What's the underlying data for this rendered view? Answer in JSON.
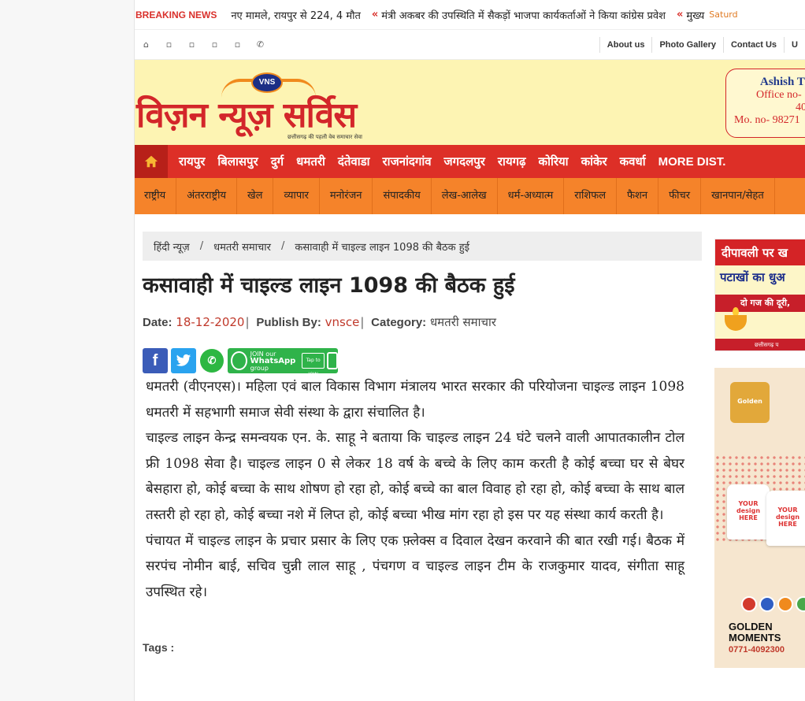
{
  "breaking": {
    "label": "BREAKING NEWS",
    "items": [
      "नए मामले, रायपुर से 224, 4 मौत",
      "मंत्री अकबर की उपस्थिति में सैकड़ों भाजपा कार्यकर्ताओं ने किया कांग्रेस प्रवेश",
      "मुख्य"
    ],
    "date": "Saturd"
  },
  "topbar": {
    "social_icons": [
      "home-icon",
      "facebook-icon",
      "twitter-icon",
      "youtube-icon",
      "instagram-icon",
      "whatsapp-icon"
    ],
    "links": [
      "About us",
      "Photo Gallery",
      "Contact Us",
      "U"
    ]
  },
  "masthead": {
    "logo_badge": "VNS",
    "logo_title": "विज़न न्यूज़ सर्विस",
    "logo_tagline": "छत्तीसगढ़ की पहली वेब समाचार सेवा",
    "contact_name": "Ashish T",
    "contact_office": "Office no-",
    "contact_office2": "40",
    "contact_mobile": "Mo. no- 98271"
  },
  "nav_red": {
    "items": [
      "रायपुर",
      "बिलासपुर",
      "दुर्ग",
      "धमतरी",
      "दंतेवाडा",
      "राजनांदगांव",
      "जगदलपुर",
      "रायगढ़",
      "कोरिया",
      "कांकेर",
      "कवर्धा"
    ],
    "more": "MORE DIST."
  },
  "nav_orange": {
    "items": [
      "राष्ट्रीय",
      "अंतरराष्ट्रीय",
      "खेल",
      "व्यापार",
      "मनोरंजन",
      "संपादकीय",
      "लेख-आलेख",
      "धर्म-अध्यात्म",
      "राशिफल",
      "फैशन",
      "फीचर",
      "खानपान/सेहत"
    ]
  },
  "breadcrumb": [
    "हिंदी न्यूज़",
    "धमतरी समाचार",
    "कसावाही में चाइल्ड लाइन 1098 की बैठक हुई"
  ],
  "article": {
    "title": "कसावाही में चाइल्ड लाइन 1098 की बैठक हुई",
    "date_label": "Date:",
    "date": "18-12-2020",
    "publish_label": "Publish By:",
    "publisher": "vnsce",
    "category_label": "Category:",
    "category": "धमतरी समाचार",
    "paragraphs": [
      "धमतरी (वीएनएस)। महिला एवं बाल विकास विभाग मंत्रालय भारत सरकार की परियोजना चाइल्ड लाइन 1098 धमतरी में सहभागी समाज सेवी संस्था के द्वारा संचालित है।",
      "चाइल्ड लाइन केन्द्र समन्वयक एन. के. साहू ने बताया कि चाइल्ड लाइन 24 घंटे चलने वाली आपातकालीन टोल फ्री 1098 सेवा है। चाइल्ड लाइन 0 से लेकर 18 वर्ष के बच्चे के लिए काम करती है कोई बच्चा घर से बेघर बेसहारा हो, कोई बच्चा के साथ शोषण हो रहा हो, कोई बच्चे का बाल विवाह हो रहा हो, कोई बच्चा के साथ बाल तस्तरी हो रहा हो, कोई बच्चा नशे में लिप्त हो, कोई बच्चा भीख मांग रहा हो इस पर यह संस्था कार्य करती है।",
      "पंचायत में चाइल्ड लाइन के प्रचार प्रसार के लिए एक फ़्लेक्स व दिवाल देखन करवाने की बात रखी गई। बैठक में सरपंच नोमीन बाई, सचिव चुन्नी लाल साहू , पंचगण व चाइल्ड लाइन टीम के राजकुमार यादव, संगीता साहू उपस्थित रहे।"
    ],
    "tags_label": "Tags :"
  },
  "share": {
    "facebook": "f",
    "whatsapp_join_line1": "JOIN our",
    "whatsapp_join_line2": "WhatsApp",
    "whatsapp_join_line3": "group",
    "tap_to_join": "Tap to JOIN"
  },
  "ads": {
    "ad1_line1": "दीपावली पर ख",
    "ad1_line2": "पटाखों का धुअ",
    "ad1_line3": "दो गज की दूरी,",
    "ad1_footer": "छत्तीसगढ़ प",
    "ad2_badge": "Golden",
    "ad2_shirt": "YOUR design HERE",
    "ad2_name": "GOLDEN MOMENTS",
    "ad2_phone": "0771-4092300"
  },
  "colors": {
    "breaking_red": "#d9302b",
    "masthead_bg": "#fdf4b3",
    "nav_red": "#dd2f27",
    "nav_orange": "#f5832a",
    "meta_value": "#c0392b"
  }
}
